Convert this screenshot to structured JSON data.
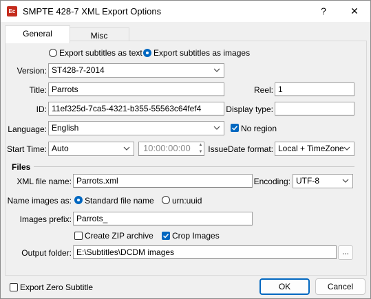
{
  "window": {
    "title": "SMPTE 428-7 XML Export Options",
    "app_icon_text": "Ec",
    "help_label": "?",
    "close_label": "✕"
  },
  "tabs": {
    "general": "General",
    "misc": "Misc"
  },
  "export_mode": {
    "as_text": "Export subtitles as text",
    "as_images": "Export subtitles as images",
    "selected": "as_images"
  },
  "fields": {
    "version_label": "Version:",
    "version_value": "ST428-7-2014",
    "title_label": "Title:",
    "title_value": "Parrots",
    "reel_label": "Reel:",
    "reel_value": "1",
    "id_label": "ID:",
    "id_value": "11ef325d-7ca5-4321-b355-55563c64fef4",
    "display_type_label": "Display type:",
    "display_type_value": "",
    "language_label": "Language:",
    "language_value": "English",
    "no_region_label": "No region",
    "no_region_checked": true,
    "start_time_label": "Start Time:",
    "start_time_value": "Auto",
    "time_value": "10:00:00:00",
    "issue_date_label": "IssueDate format:",
    "issue_date_value": "Local + TimeZone"
  },
  "files": {
    "section_label": "Files",
    "xml_file_label": "XML file name:",
    "xml_file_value": "Parrots.xml",
    "encoding_label": "Encoding:",
    "encoding_value": "UTF-8",
    "name_images_label": "Name images as:",
    "standard_label": "Standard file name",
    "urn_label": "urn:uuid",
    "name_selected": "standard",
    "prefix_label": "Images prefix:",
    "prefix_value": "Parrots_",
    "create_zip_label": "Create ZIP archive",
    "create_zip_checked": false,
    "crop_images_label": "Crop Images",
    "crop_images_checked": true,
    "output_folder_label": "Output folder:",
    "output_folder_value": "E:\\Subtitles\\DCDM images",
    "browse_label": "..."
  },
  "footer": {
    "export_zero_label": "Export Zero Subtitle",
    "export_zero_checked": false,
    "ok_label": "OK",
    "cancel_label": "Cancel"
  },
  "colors": {
    "accent": "#0067c0",
    "app_icon": "#c42b1c"
  }
}
